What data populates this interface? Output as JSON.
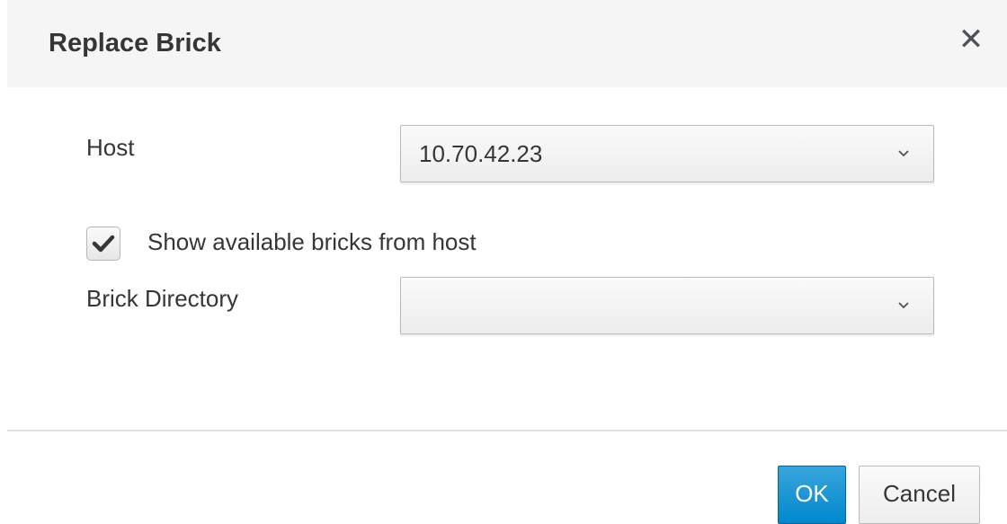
{
  "dialog": {
    "title": "Replace Brick",
    "close_glyph": "✕",
    "close_icon": "close-icon"
  },
  "form": {
    "host": {
      "label": "Host",
      "value": "10.70.42.23",
      "icon": "chevron-down-icon"
    },
    "show_bricks": {
      "label": "Show available bricks from host",
      "checked": true,
      "icon": "checkmark-icon"
    },
    "brick_directory": {
      "label": "Brick Directory",
      "value": "",
      "icon": "chevron-down-icon"
    }
  },
  "footer": {
    "ok_label": "OK",
    "cancel_label": "Cancel"
  },
  "colors": {
    "primary": "#0088ce",
    "header_bg": "#f5f5f5",
    "text": "#363636"
  }
}
